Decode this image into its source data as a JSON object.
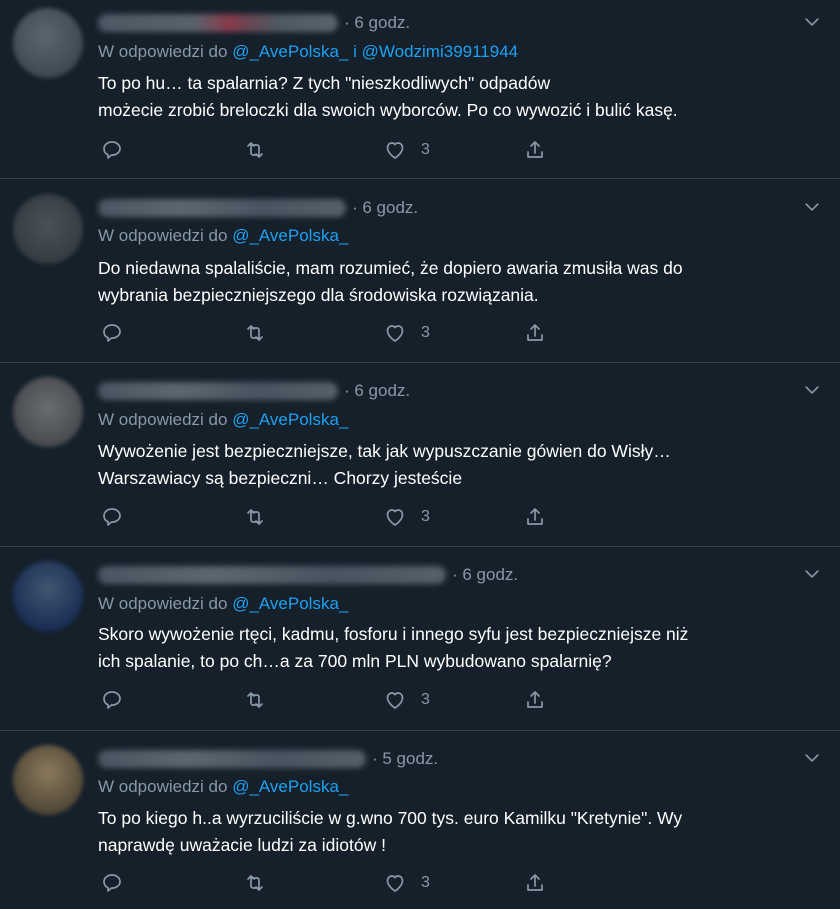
{
  "colors": {
    "background": "#15202b",
    "divider": "#38444d",
    "muted": "#8899a6",
    "link": "#1da1f2",
    "text": "#ffffff"
  },
  "tweets": [
    {
      "time": "· 6 godz.",
      "reply_prefix": "W odpowiedzi do ",
      "handles": [
        "@_AvePolska_",
        "i",
        "@Wodzimi39911944"
      ],
      "text": "To po hu… ta spalarnia? Z tych \"nieszkodliwych\" odpadów\nmożecie zrobić breloczki dla swoich wyborców. Po co wywozić i bulić kasę.",
      "likes": "3"
    },
    {
      "time": "· 6 godz.",
      "reply_prefix": "W odpowiedzi do ",
      "handles": [
        "@_AvePolska_"
      ],
      "text": "Do niedawna spalaliście, mam rozumieć, że dopiero awaria zmusiła was do\nwybrania bezpieczniejszego dla środowiska  rozwiązania.",
      "likes": "3"
    },
    {
      "time": "· 6 godz.",
      "reply_prefix": "W odpowiedzi do ",
      "handles": [
        "@_AvePolska_"
      ],
      "text": "Wywożenie jest bezpieczniejsze, tak jak wypuszczanie gówien do Wisły…\nWarszawiacy są bezpieczni… Chorzy jesteście",
      "likes": "3"
    },
    {
      "time": "· 6 godz.",
      "reply_prefix": "W odpowiedzi do ",
      "handles": [
        "@_AvePolska_"
      ],
      "text": "Skoro wywożenie rtęci, kadmu, fosforu i innego syfu jest bezpieczniejsze niż\nich spalanie, to po ch…a za 700 mln PLN wybudowano spalarnię?",
      "likes": "3"
    },
    {
      "time": "· 5 godz.",
      "reply_prefix": "W odpowiedzi do ",
      "handles": [
        "@_AvePolska_"
      ],
      "text": "To po kiego h..a wyrzuciliście w g.wno 700 tys. euro Kamilku \"Kretynie\". Wy\nnaprawdę uważacie ludzi za idiotów !",
      "likes": "3"
    }
  ],
  "icons": {
    "reply": "reply-icon",
    "retweet": "retweet-icon",
    "like": "heart-icon",
    "share": "share-icon",
    "menu": "chevron-down-icon"
  }
}
